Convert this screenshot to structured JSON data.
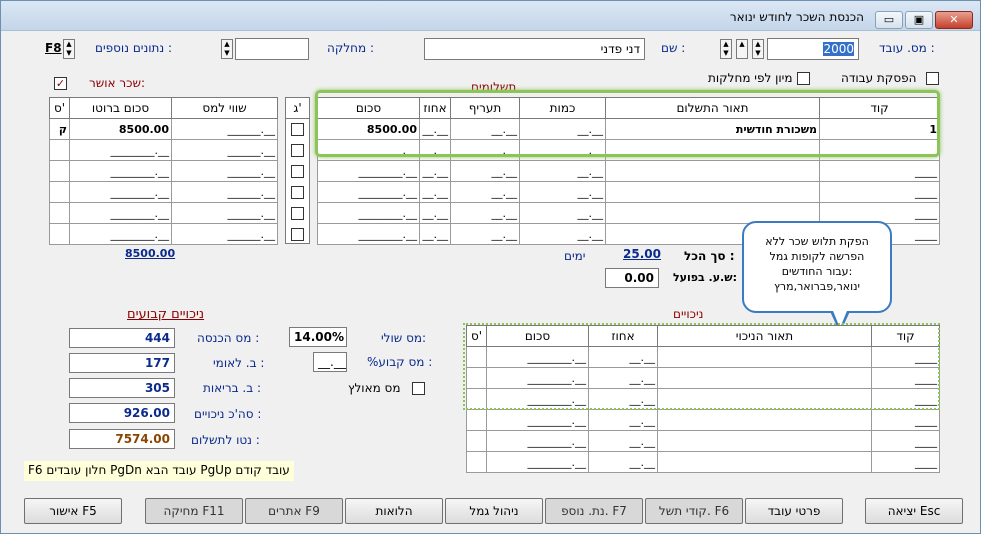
{
  "window": {
    "title": "הכנסת השכר לחודש ינואר",
    "minimize": "▭",
    "restore": "▣",
    "close": "✕"
  },
  "header": {
    "employee_no_label": "מס. עובד :",
    "employee_no_value": "2000",
    "name_label": "שם :",
    "name_value": "דני פדני",
    "department_label": "מחלקה :",
    "department_value": "",
    "extra_data_label": "נתונים נוספים :",
    "extra_data_key": "F8",
    "stop_work_label": "הפסקת עבודה",
    "sort_by_dept_label": "מיון לפי מחלקות",
    "approved_salary_label": "שכר אושר:",
    "approved_salary_checked": "✓"
  },
  "payments": {
    "section_title": "תשלומים",
    "columns": [
      "קוד",
      "תאור התשלום",
      "כמות",
      "תעריף",
      "אחוז",
      "סכום"
    ],
    "rows": [
      [
        "1",
        "משכורת חודשית",
        "__.__",
        "__.__",
        "__.__",
        "8500.00"
      ],
      [
        "____",
        "",
        "__.__",
        "__.__",
        "__.__",
        "________.__"
      ],
      [
        "____",
        "",
        "__.__",
        "__.__",
        "__.__",
        "________.__"
      ],
      [
        "____",
        "",
        "__.__",
        "__.__",
        "__.__",
        "________.__"
      ],
      [
        "____",
        "",
        "__.__",
        "__.__",
        "__.__",
        "________.__"
      ],
      [
        "____",
        "",
        "__.__",
        "__.__",
        "__.__",
        "________.__"
      ]
    ],
    "side_columns": [
      "ג'",
      "שווי למס",
      "סכום ברוטו",
      "ס'"
    ],
    "side_rows": [
      [
        "",
        "______.__",
        "8500.00",
        "ק"
      ],
      [
        "",
        "______.__",
        "________.__",
        ""
      ],
      [
        "",
        "______.__",
        "________.__",
        ""
      ],
      [
        "",
        "______.__",
        "________.__",
        ""
      ],
      [
        "",
        "______.__",
        "________.__",
        ""
      ],
      [
        "",
        "______.__",
        "________.__",
        ""
      ]
    ],
    "total_label": "סך הכל :",
    "total_days": "25.00",
    "days_label": "ימים",
    "actual_hours_label": "ש.ע. בפועל:",
    "actual_hours_value": "0.00",
    "gross_total": "8500.00"
  },
  "deductions": {
    "section_title": "ניכויים",
    "columns": [
      "קוד",
      "תאור הניכוי",
      "אחוז",
      "סכום",
      "ס'"
    ],
    "rows": [
      [
        "____",
        "",
        "__.__",
        "________.__",
        ""
      ],
      [
        "____",
        "",
        "__.__",
        "________.__",
        ""
      ],
      [
        "____",
        "",
        "__.__",
        "________.__",
        ""
      ],
      [
        "____",
        "",
        "__.__",
        "________.__",
        ""
      ],
      [
        "____",
        "",
        "__.__",
        "________.__",
        ""
      ],
      [
        "____",
        "",
        "__.__",
        "________.__",
        ""
      ]
    ]
  },
  "fixed_deductions": {
    "section_title": "ניכויים קבועים",
    "income_tax_label": "מס הכנסה :",
    "income_tax_value": "444",
    "national_ins_label": "ב. לאומי :",
    "national_ins_value": "177",
    "health_ins_label": "ב. בריאות :",
    "health_ins_value": "305",
    "total_deductions_label": "סה'כ ניכויים :",
    "total_deductions_value": "926.00",
    "net_pay_label": "נטו לתשלום :",
    "net_pay_value": "7574.00",
    "marginal_tax_label": "מס שולי:",
    "marginal_tax_value": "14.00%",
    "fixed_tax_label": "%מס קבוע :",
    "fixed_tax_value": "__.__",
    "tax_mark_label": "מס מאולץ"
  },
  "tooltip": {
    "lines": [
      "הפקת תלוש שכר ללא",
      "הפרשה לקופות גמל",
      "עבור החודשים:",
      "ינואר,פברואר,מרץ"
    ]
  },
  "hint": "F6 חלון עובדים  PgDn עובד הבא  PgUp עובד קודם",
  "buttons": {
    "exit": "יציאה Esc",
    "employee_details": "פרטי עובד",
    "payment_codes": "קודי תשל. F6",
    "extra_data": "נת. נוספ. F7",
    "provident": "ניהול גמל",
    "loans": "הלואות",
    "alerts": "אתרים F9",
    "delete": "מחיקה F11",
    "approve": "אישור F5"
  },
  "colors": {
    "accent_green": "#8dc45a",
    "blue_label": "#0a2a8c",
    "red_label": "#8b0000",
    "bubble_border": "#3b7cc0",
    "net_color": "#8b4500"
  }
}
